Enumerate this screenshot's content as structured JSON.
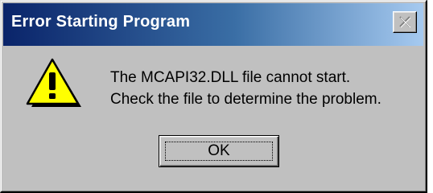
{
  "dialog": {
    "title": "Error Starting Program",
    "message_line1": "The MCAPI32.DLL file cannot start.",
    "message_line2": "Check the file to determine the problem.",
    "ok_label": "OK"
  },
  "icons": {
    "close": "close-icon",
    "warning": "warning-icon"
  },
  "colors": {
    "titlebar_start": "#0a246a",
    "titlebar_end": "#a6caf0",
    "face": "#c0c0c0",
    "warning_fill": "#ffff00"
  }
}
